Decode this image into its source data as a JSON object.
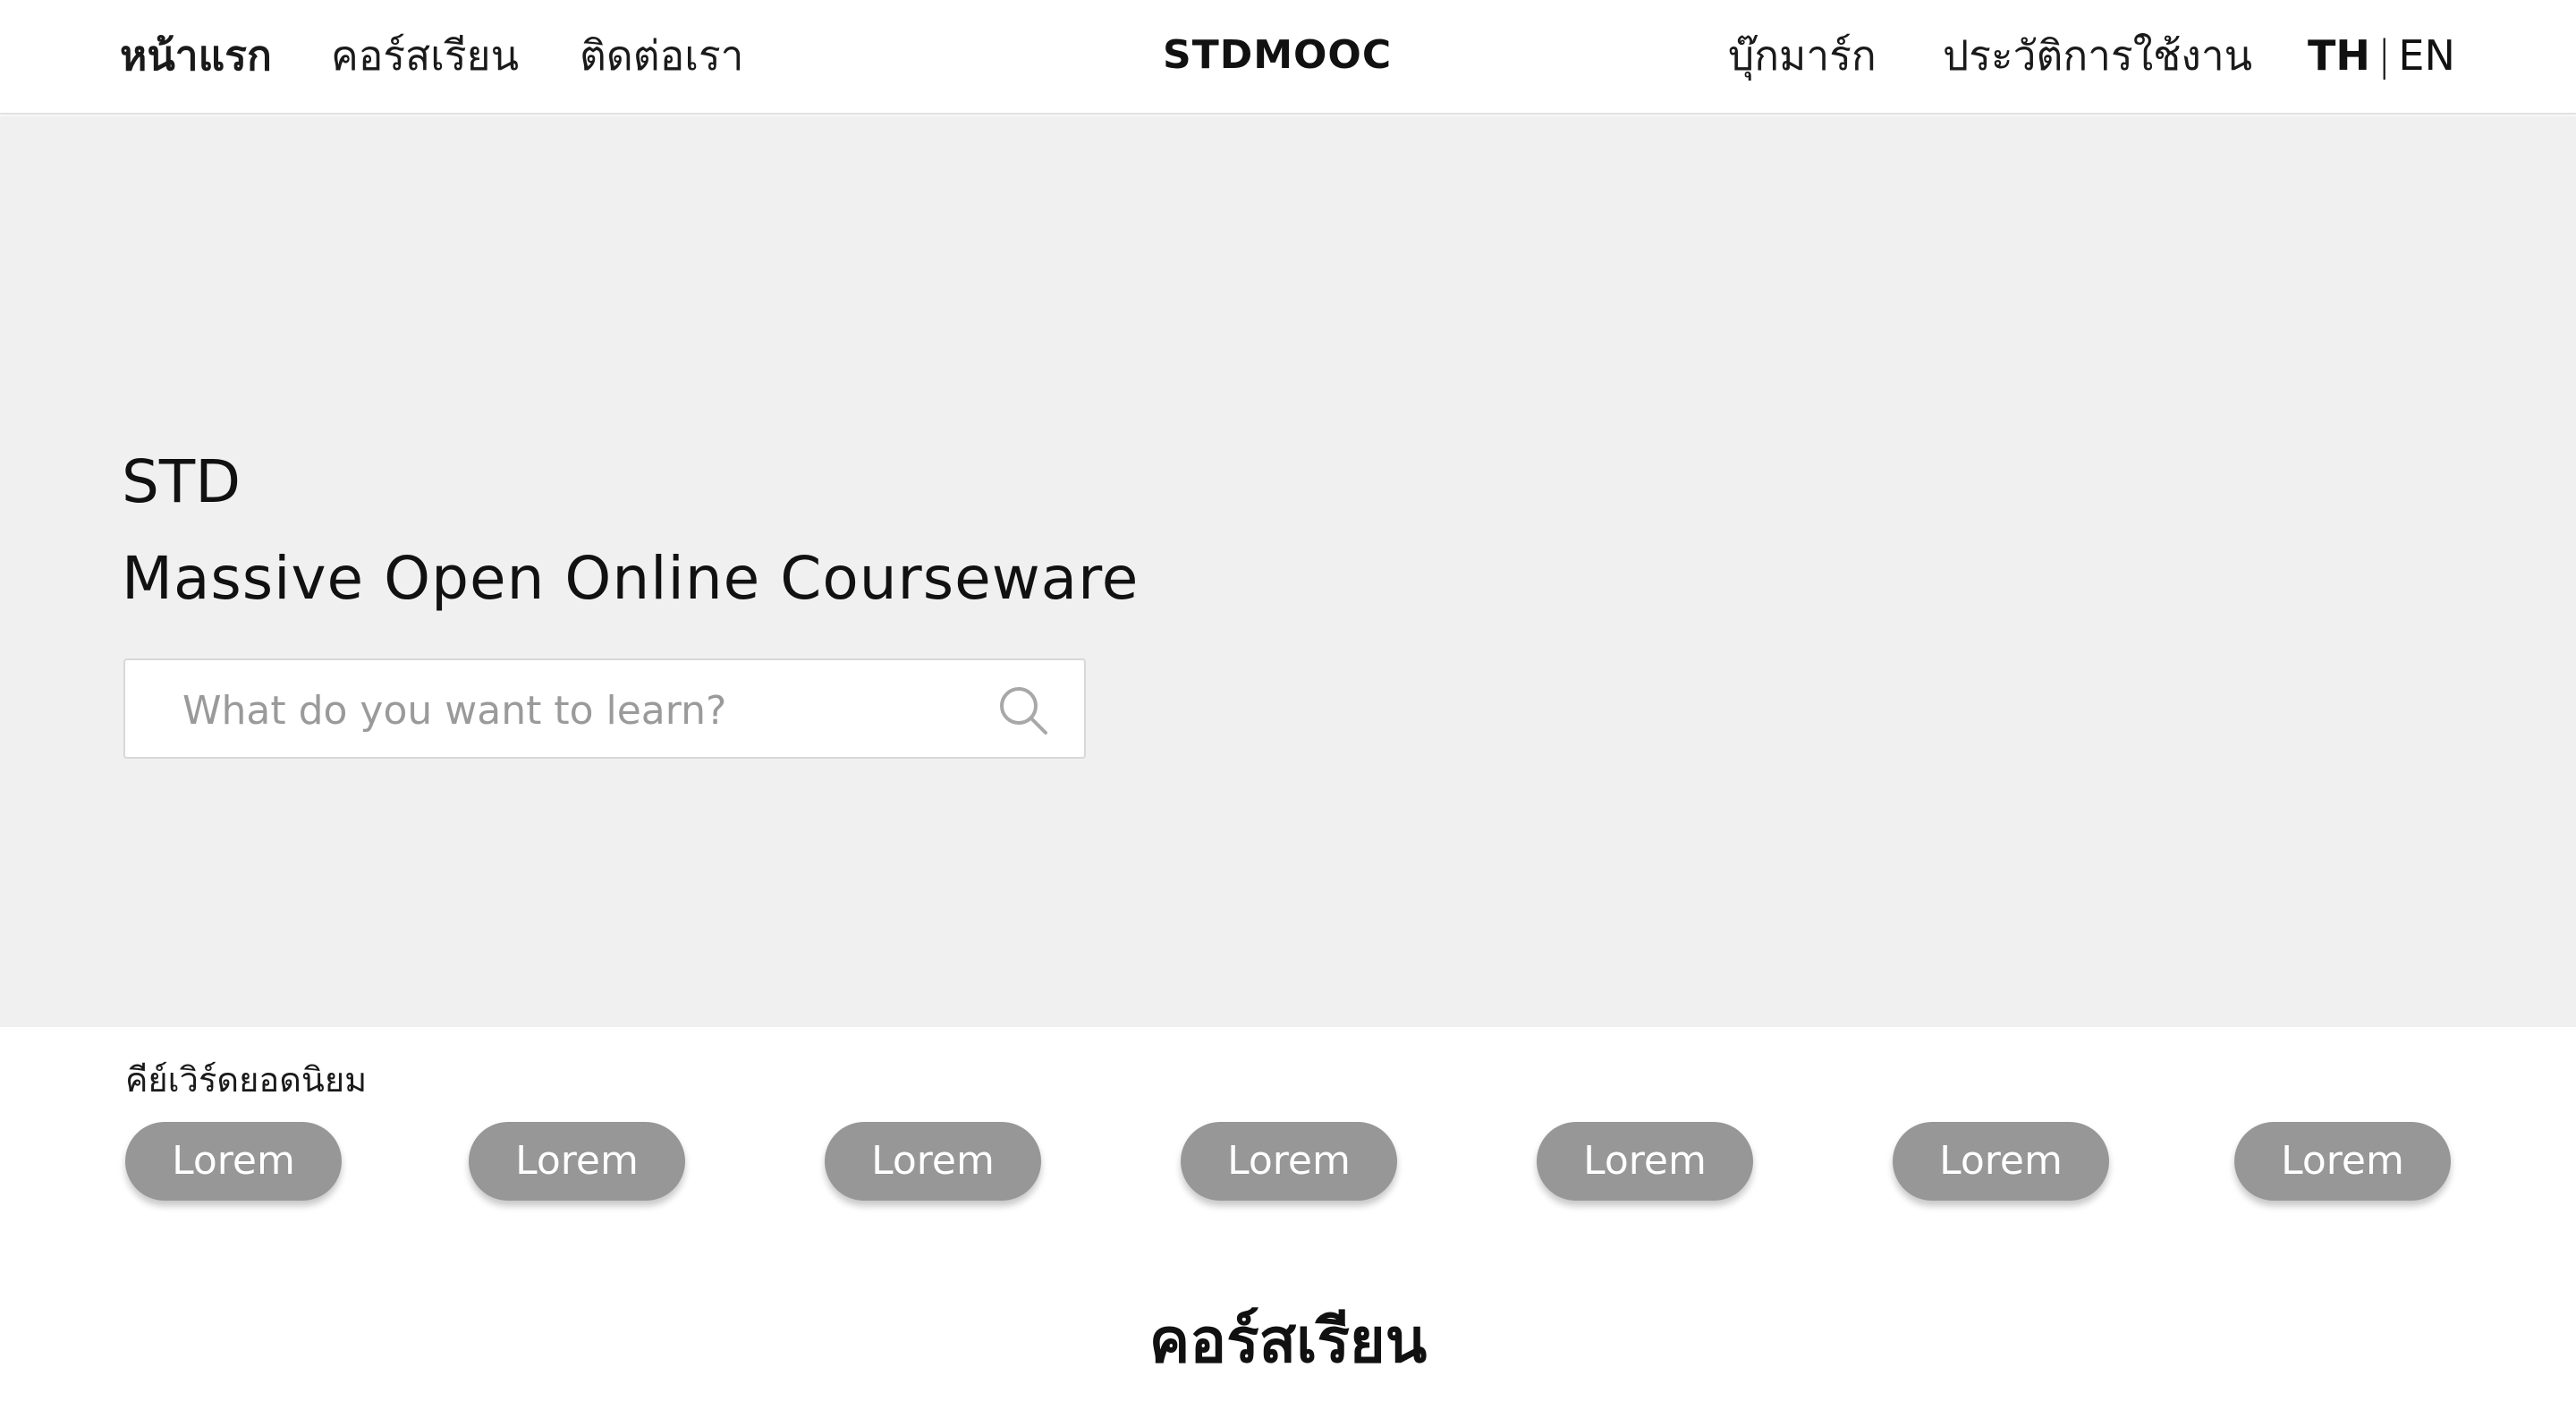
{
  "nav": {
    "left_links": [
      "หน้าแรก",
      "คอร์สเรียน",
      "ติดต่อเรา"
    ],
    "brand": "STDMOOC",
    "right_links": [
      "บุ๊กมาร์ก",
      "ประวัติการใช้งาน"
    ],
    "lang_th": "TH",
    "lang_sep": "|",
    "lang_en": "EN"
  },
  "hero": {
    "title_line1": "STD",
    "title_line2": "Massive Open Online Courseware",
    "search_placeholder": "What do you want to learn?",
    "search_icon": "search-icon"
  },
  "keywords": {
    "heading": "คีย์เวิร์ดยอดนิยม",
    "items": [
      "Lorem",
      "Lorem",
      "Lorem",
      "Lorem",
      "Lorem",
      "Lorem",
      "Lorem"
    ]
  },
  "courses": {
    "heading": "คอร์สเรียน"
  },
  "colors": {
    "hero_bg": "#f0f0f0",
    "pill_bg": "#979797",
    "placeholder": "#9a9a9a"
  }
}
